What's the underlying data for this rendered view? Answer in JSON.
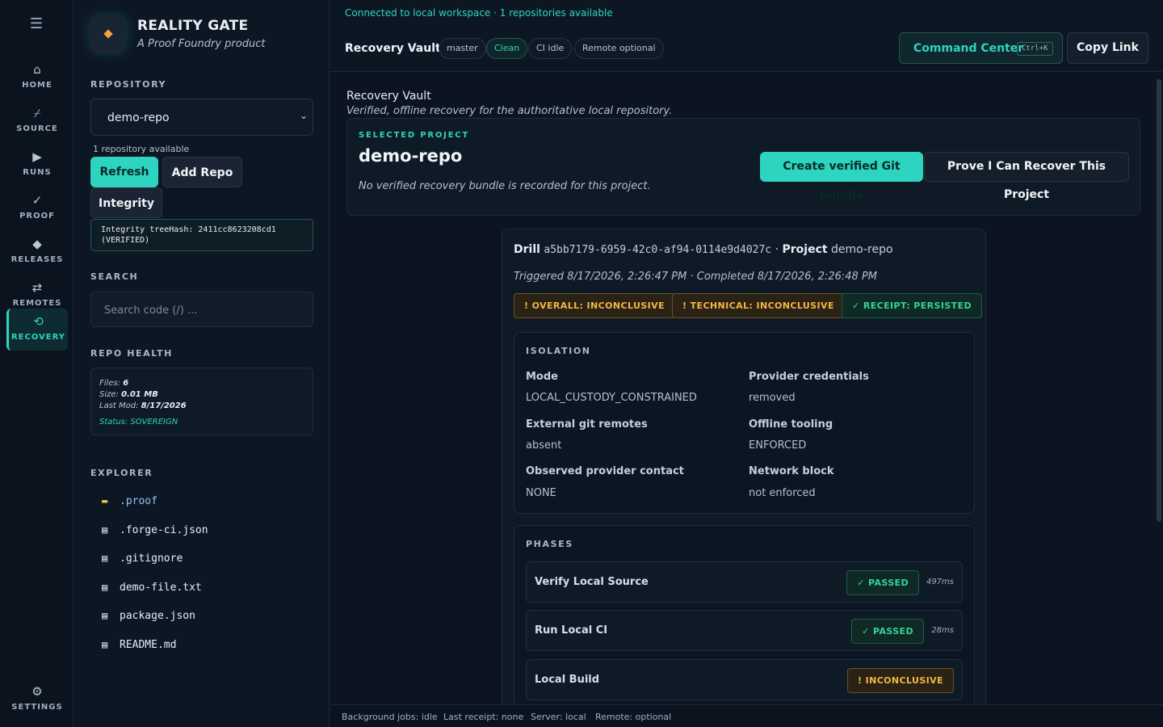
{
  "nav": {
    "items": [
      {
        "icon": "home-icon",
        "label": "HOME"
      },
      {
        "icon": "source-icon",
        "label": "SOURCE"
      },
      {
        "icon": "runs-icon",
        "label": "RUNS"
      },
      {
        "icon": "proof-icon",
        "label": "PROOF"
      },
      {
        "icon": "releases-icon",
        "label": "RELEASES"
      },
      {
        "icon": "remotes-icon",
        "label": "REMOTES"
      },
      {
        "icon": "recovery-icon",
        "label": "RECOVERY",
        "active": true
      }
    ],
    "settings_label": "SETTINGS"
  },
  "brand": {
    "name": "REALITY GATE",
    "tagline": "A Proof Foundry product"
  },
  "sidebar": {
    "repository_heading": "REPOSITORY",
    "selected_repo": "demo-repo",
    "repo_count": "1 repository available",
    "refresh_label": "Refresh",
    "add_repo_label": "Add Repo",
    "integrity_label": "Integrity",
    "integrity_text": "Integrity treeHash: 2411cc8623208cd1 (VERIFIED)",
    "search_heading": "SEARCH",
    "search_placeholder": "Search code (/) ...",
    "health_heading": "REPO HEALTH",
    "health": {
      "files_label": "Files:",
      "files": "6",
      "size_label": "Size:",
      "size": "0.01 MB",
      "lastmod_label": "Last Mod:",
      "lastmod": "8/17/2026",
      "status": "Status: SOVEREIGN"
    },
    "explorer_heading": "EXPLORER",
    "files": [
      {
        "name": ".proof",
        "type": "folder"
      },
      {
        "name": ".forge-ci.json",
        "type": "file"
      },
      {
        "name": ".gitignore",
        "type": "file"
      },
      {
        "name": "demo-file.txt",
        "type": "file"
      },
      {
        "name": "package.json",
        "type": "file"
      },
      {
        "name": "README.md",
        "type": "file"
      }
    ]
  },
  "topbar": {
    "connection": "Connected to local workspace · 1 repositories available",
    "page_name": "Recovery Vault",
    "pills": [
      "master",
      "Clean",
      "CI idle",
      "Remote optional"
    ],
    "command_center": "Command Center",
    "shortcut": "Ctrl+K",
    "copy_link": "Copy Link"
  },
  "main": {
    "title": "Recovery Vault",
    "subtitle": "Verified, offline recovery for the authoritative local repository.",
    "project": {
      "label": "SELECTED PROJECT",
      "name": "demo-repo",
      "note": "No verified recovery bundle is recorded for this project.",
      "create_bundle": "Create verified Git bundle",
      "prove_recover": "Prove I Can Recover This Project"
    },
    "drill": {
      "drill_label": "Drill",
      "drill_id": "a5bb7179-6959-42c0-af94-0114e9d4027c",
      "project_label": "Project",
      "project": "demo-repo",
      "times": "Triggered 8/17/2026, 2:26:47 PM · Completed 8/17/2026, 2:26:48 PM",
      "badges": [
        {
          "text": "! OVERALL: INCONCLUSIVE",
          "kind": "warn"
        },
        {
          "text": "! TECHNICAL: INCONCLUSIVE",
          "kind": "warn"
        },
        {
          "text": "✓ RECEIPT: PERSISTED",
          "kind": "ok"
        }
      ],
      "isolation_heading": "ISOLATION",
      "isolation": [
        {
          "key": "Mode",
          "value": "LOCAL_CUSTODY_CONSTRAINED"
        },
        {
          "key": "Provider credentials",
          "value": "removed"
        },
        {
          "key": "External git remotes",
          "value": "absent"
        },
        {
          "key": "Offline tooling",
          "value": "ENFORCED"
        },
        {
          "key": "Observed provider contact",
          "value": "NONE"
        },
        {
          "key": "Network block",
          "value": "not enforced"
        }
      ],
      "phases_heading": "PHASES",
      "phases": [
        {
          "name": "Verify Local Source",
          "status": "✓ PASSED",
          "kind": "ok",
          "time": "497ms"
        },
        {
          "name": "Run Local CI",
          "status": "✓ PASSED",
          "kind": "ok",
          "time": "28ms"
        },
        {
          "name": "Local Build",
          "status": "! INCONCLUSIVE",
          "kind": "warn",
          "time": ""
        }
      ]
    }
  },
  "statusbar": {
    "jobs": "Background jobs: idle",
    "receipt": "Last receipt: none",
    "server": "Server: local",
    "remote": "Remote: optional"
  },
  "colors": {
    "accent": "#2dd4bf",
    "warn": "#f5b642",
    "ok": "#34d399",
    "background": "#0b1420"
  }
}
